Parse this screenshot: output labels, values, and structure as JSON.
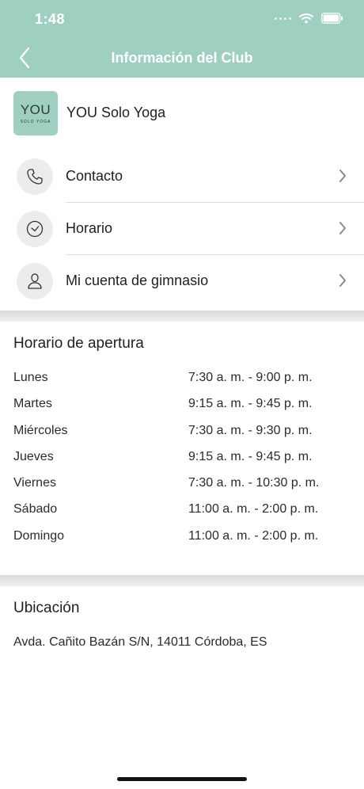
{
  "status_bar": {
    "time": "1:48"
  },
  "nav": {
    "title": "Información del Club"
  },
  "club": {
    "logo_text": "YOU",
    "logo_subtext": "SOLO YOGA",
    "name": "YOU Solo Yoga"
  },
  "menu": {
    "items": [
      {
        "label": "Contacto",
        "icon": "phone-icon"
      },
      {
        "label": "Horario",
        "icon": "clock-icon"
      },
      {
        "label": "Mi cuenta de gimnasio",
        "icon": "person-icon"
      }
    ]
  },
  "hours": {
    "title": "Horario de apertura",
    "rows": [
      {
        "day": "Lunes",
        "time": "7:30 a. m. - 9:00 p. m."
      },
      {
        "day": "Martes",
        "time": "9:15 a. m. - 9:45 p. m."
      },
      {
        "day": "Miércoles",
        "time": "7:30 a. m. - 9:30 p. m."
      },
      {
        "day": "Jueves",
        "time": "9:15 a. m. - 9:45 p. m."
      },
      {
        "day": "Viernes",
        "time": "7:30 a. m. - 10:30 p. m."
      },
      {
        "day": "Sábado",
        "time": "11:00 a. m. - 2:00 p. m."
      },
      {
        "day": "Domingo",
        "time": "11:00 a. m. - 2:00 p. m."
      }
    ]
  },
  "location": {
    "title": "Ubicación",
    "address": "Avda. Cañito Bazán S/N, 14011 Córdoba, ES"
  },
  "colors": {
    "brand": "#9fcfc0",
    "text": "#1f1f1f",
    "icon_bg": "#ececec"
  }
}
